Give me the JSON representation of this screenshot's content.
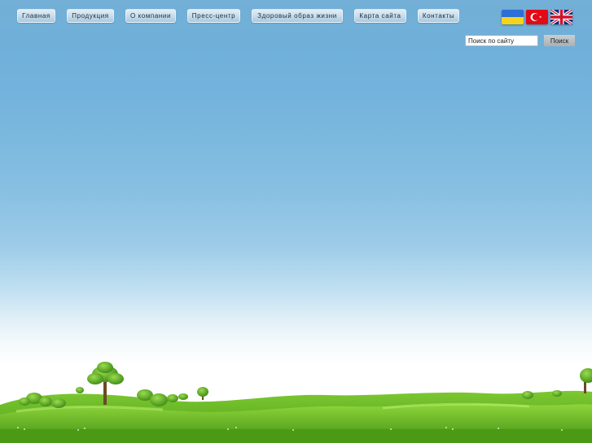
{
  "nav": {
    "items": [
      {
        "label": "Главная"
      },
      {
        "label": "Продукция"
      },
      {
        "label": "О компании"
      },
      {
        "label": "Пресс-центр"
      },
      {
        "label": "Здоровый образ жизни"
      },
      {
        "label": "Карта сайта"
      },
      {
        "label": "Контакты"
      }
    ]
  },
  "languages": {
    "items": [
      {
        "icon": "ukraine-flag-icon"
      },
      {
        "icon": "turkey-flag-icon"
      },
      {
        "icon": "uk-flag-icon"
      }
    ]
  },
  "search": {
    "value": "Поиск по сайту",
    "button_label": "Поиск"
  },
  "colors": {
    "sky_top": "#6fb0d9",
    "sky_bottom": "#ffffff",
    "grass": "#5aae1c",
    "nav_button": "#c5dbea"
  }
}
